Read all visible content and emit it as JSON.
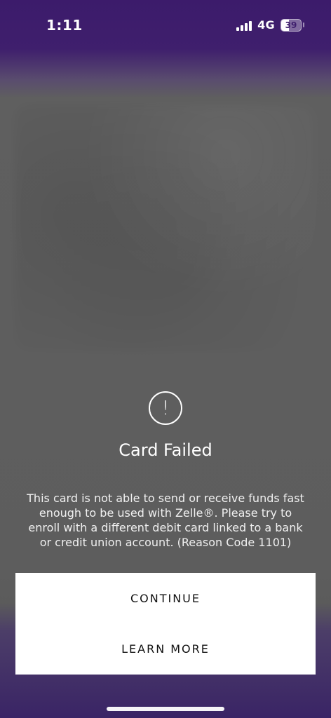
{
  "status_bar": {
    "time": "1:11",
    "network": "4G",
    "battery": "39"
  },
  "dialog": {
    "title": "Card Failed",
    "message": "This card is not able to send or receive funds fast enough to be used with Zelle®. Please try to enroll with a different debit card linked to a bank or credit union account. (Reason Code 1101)",
    "alert_icon": "!"
  },
  "buttons": {
    "continue": "CONTINUE",
    "learn_more": "LEARN MORE"
  },
  "colors": {
    "top_accent": "#3f1f6d",
    "overlay": "#5b5b5b",
    "button_panel": "#ffffff",
    "text": "#ffffff"
  },
  "icons": {
    "signal": "signal-icon",
    "battery": "battery-icon",
    "alert": "alert-icon"
  }
}
